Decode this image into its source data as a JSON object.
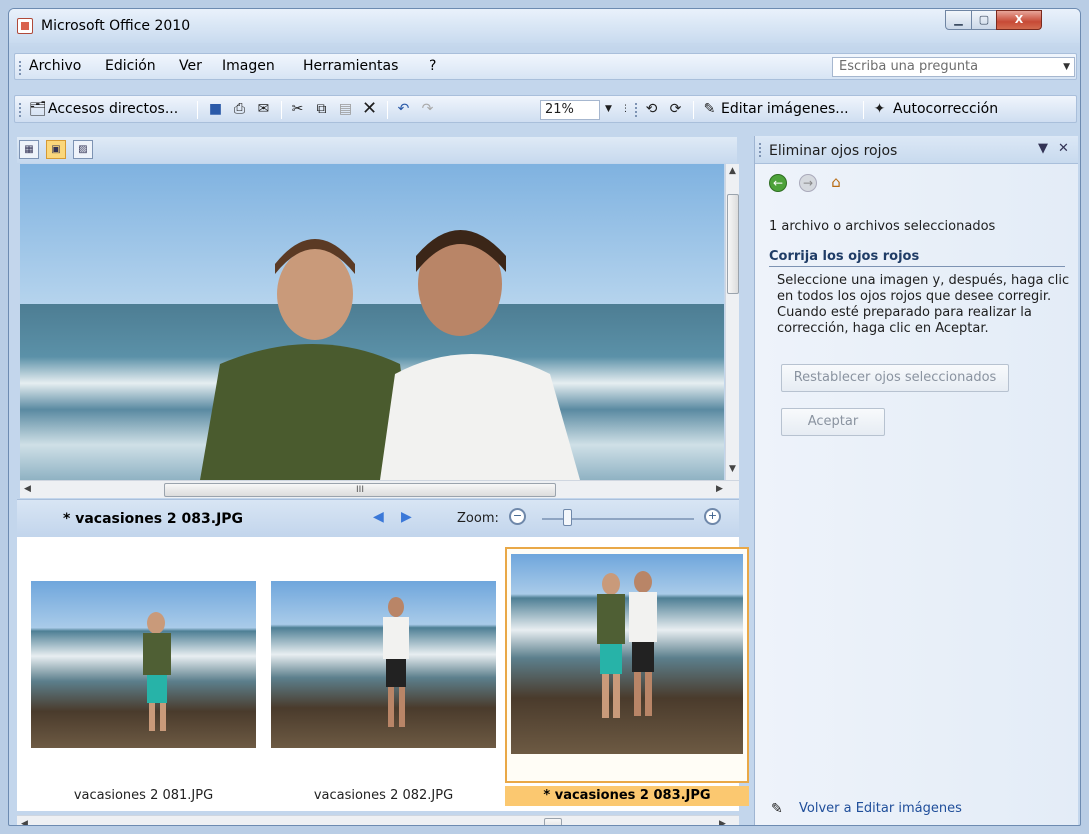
{
  "window": {
    "title": "Microsoft Office 2010",
    "min_glyph": "▁",
    "max_glyph": "▢",
    "close_glyph": "X"
  },
  "menu": {
    "items": [
      "Archivo",
      "Edición",
      "Ver",
      "Imagen",
      "Herramientas",
      "?"
    ],
    "ask_placeholder": "Escriba una pregunta"
  },
  "toolbar": {
    "shortcuts_label": "Accesos directos...",
    "zoom_value": "21%",
    "edit_images_label": "Editar imágenes...",
    "autocorrect_label": "Autocorrección"
  },
  "viewer": {
    "filename": "* vacasiones 2 083.JPG",
    "zoom_label": "Zoom:",
    "hscroll_glyph": "III"
  },
  "thumbnails": [
    {
      "label": "vacasiones 2 081.JPG",
      "selected": false
    },
    {
      "label": "vacasiones 2 082.JPG",
      "selected": false
    },
    {
      "label": "* vacasiones 2 083.JPG",
      "selected": true
    }
  ],
  "pane": {
    "title": "Eliminar ojos rojos",
    "selection_info": "1 archivo o archivos seleccionados",
    "heading": "Corrija los ojos rojos",
    "description": "Seleccione una imagen y, después, haga clic en todos los ojos rojos que desee corregir. Cuando esté preparado para realizar la corrección, haga clic en Aceptar.",
    "reset_button": "Restablecer ojos seleccionados",
    "accept_button": "Aceptar",
    "footer_link": "Volver a Editar imágenes"
  },
  "colors": {
    "accent": "#fbc870",
    "pane_heading": "#1f3c66",
    "link": "#1f4e9a"
  }
}
